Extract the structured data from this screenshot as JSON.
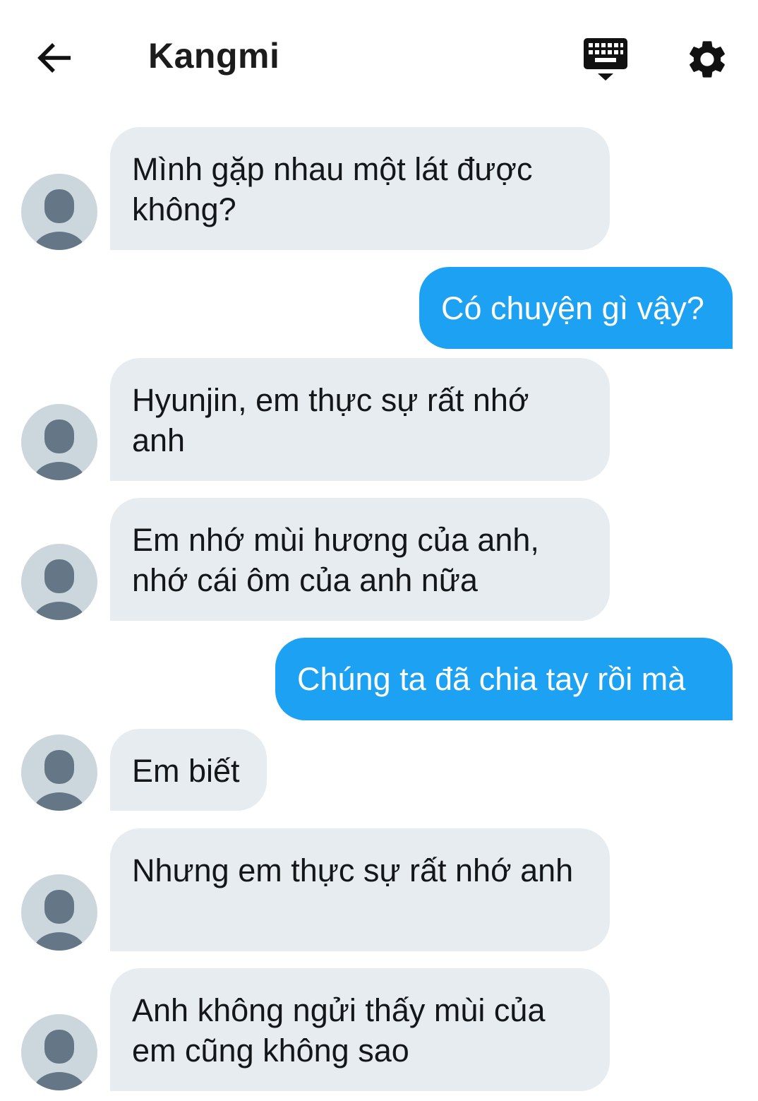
{
  "header": {
    "title": "Kangmi",
    "back_icon": "arrow-left-icon",
    "keyboard_icon": "keyboard-hide-icon",
    "settings_icon": "gear-icon"
  },
  "colors": {
    "incoming_bubble": "#e6ecf0",
    "outgoing_bubble": "#1da1f2",
    "avatar_bg": "#ccd6dd",
    "avatar_fg": "#657786"
  },
  "messages": [
    {
      "from": "them",
      "text": "Mình gặp nhau một lát được không?"
    },
    {
      "from": "me",
      "text": "Có chuyện gì vậy?"
    },
    {
      "from": "them",
      "text": "Hyunjin, em thực sự rất nhớ anh"
    },
    {
      "from": "them",
      "text": "Em nhớ mùi hương của anh, nhớ cái ôm của anh nữa"
    },
    {
      "from": "me",
      "text": "Chúng ta đã chia tay rồi mà"
    },
    {
      "from": "them",
      "text": "Em biết"
    },
    {
      "from": "them",
      "text": "Nhưng em thực sự rất nhớ anh"
    },
    {
      "from": "them",
      "text": "Anh không ngửi thấy mùi của em cũng không sao"
    }
  ]
}
